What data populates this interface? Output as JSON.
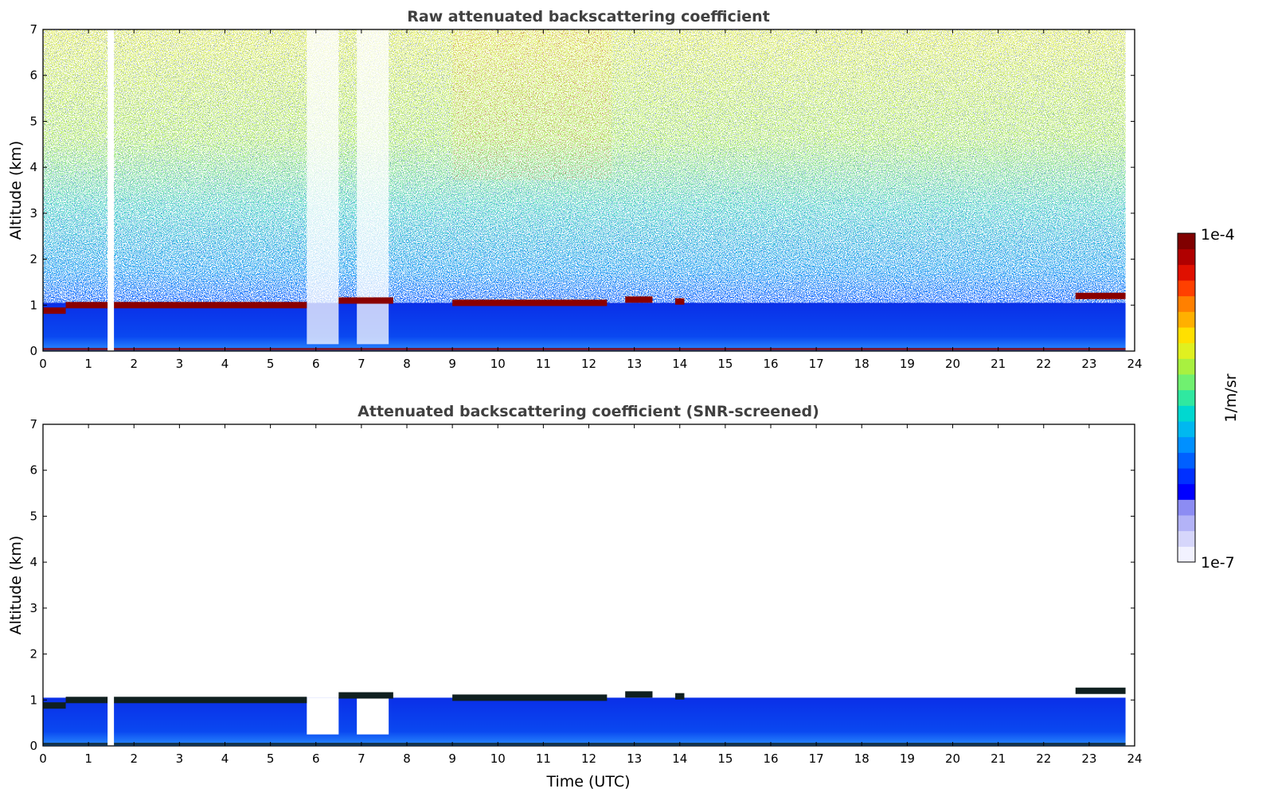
{
  "chart_data": [
    {
      "type": "heatmap",
      "title": "Raw attenuated backscattering coefficient",
      "xlabel": "",
      "ylabel": "Altitude (km)",
      "xlim": [
        0,
        24
      ],
      "ylim": [
        0,
        7
      ],
      "xticks": [
        "0",
        "1",
        "2",
        "3",
        "4",
        "5",
        "6",
        "7",
        "8",
        "9",
        "10",
        "11",
        "12",
        "13",
        "14",
        "15",
        "16",
        "17",
        "18",
        "19",
        "20",
        "21",
        "22",
        "23",
        "24"
      ],
      "yticks": [
        "0",
        "1",
        "2",
        "3",
        "4",
        "5",
        "6",
        "7"
      ],
      "data_end_hour": 23.8,
      "features": {
        "cloud_layer": [
          {
            "start": 0.0,
            "end": 0.5,
            "alt": 0.88
          },
          {
            "start": 0.5,
            "end": 5.8,
            "alt": 1.0
          },
          {
            "start": 6.5,
            "end": 7.7,
            "alt": 1.1
          },
          {
            "start": 9.0,
            "end": 12.4,
            "alt": 1.05
          },
          {
            "start": 12.8,
            "end": 13.4,
            "alt": 1.12
          },
          {
            "start": 13.9,
            "end": 14.1,
            "alt": 1.08
          },
          {
            "start": 22.7,
            "end": 23.8,
            "alt": 1.2
          }
        ],
        "boundary_layer_top_km": 1.05,
        "data_gaps_hours": [
          [
            1.42,
            1.56
          ]
        ],
        "clear_columns": [
          [
            5.8,
            6.5
          ],
          [
            6.9,
            7.6
          ]
        ],
        "high_signal_windows": [
          [
            9.0,
            12.5
          ]
        ]
      }
    },
    {
      "type": "heatmap",
      "title": "Attenuated backscattering coefficient (SNR-screened)",
      "xlabel": "Time (UTC)",
      "ylabel": "Altitude (km)",
      "xlim": [
        0,
        24
      ],
      "ylim": [
        0,
        7
      ],
      "xticks": [
        "0",
        "1",
        "2",
        "3",
        "4",
        "5",
        "6",
        "7",
        "8",
        "9",
        "10",
        "11",
        "12",
        "13",
        "14",
        "15",
        "16",
        "17",
        "18",
        "19",
        "20",
        "21",
        "22",
        "23",
        "24"
      ],
      "yticks": [
        "0",
        "1",
        "2",
        "3",
        "4",
        "5",
        "6",
        "7"
      ],
      "data_end_hour": 23.8,
      "features": {
        "cloud_layer": [
          {
            "start": 0.0,
            "end": 0.5,
            "alt": 0.88
          },
          {
            "start": 0.5,
            "end": 5.8,
            "alt": 1.0
          },
          {
            "start": 6.5,
            "end": 7.7,
            "alt": 1.1
          },
          {
            "start": 9.0,
            "end": 12.4,
            "alt": 1.05
          },
          {
            "start": 12.8,
            "end": 13.4,
            "alt": 1.12
          },
          {
            "start": 13.9,
            "end": 14.1,
            "alt": 1.08
          },
          {
            "start": 22.7,
            "end": 23.8,
            "alt": 1.2
          }
        ],
        "boundary_layer_top_km": 1.05,
        "data_gaps_hours": [
          [
            1.42,
            1.56
          ]
        ],
        "clear_columns": [
          [
            5.8,
            6.5
          ],
          [
            6.9,
            7.6
          ]
        ]
      }
    }
  ],
  "colorbar": {
    "max_label": "1e-4",
    "min_label": "1e-7",
    "unit_label": "1/m/sr",
    "colors": [
      "#f2f2ff",
      "#d6d6fb",
      "#b3b3f7",
      "#8c8cf3",
      "#0000ff",
      "#0030ff",
      "#0060ff",
      "#0090ff",
      "#00b8f0",
      "#00d8d0",
      "#30e8a0",
      "#70f070",
      "#a8f040",
      "#e0f020",
      "#ffe000",
      "#ffb000",
      "#ff8000",
      "#ff4000",
      "#e01000",
      "#b00000",
      "#800000"
    ]
  }
}
